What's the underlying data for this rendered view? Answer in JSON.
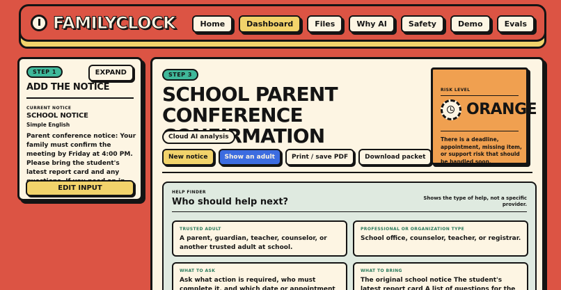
{
  "brand": {
    "name": "FAMILYCLOCK",
    "logo_icon": "clock-logo-icon"
  },
  "nav": {
    "items": [
      {
        "label": "Home",
        "active": false
      },
      {
        "label": "Dashboard",
        "active": true
      },
      {
        "label": "Files",
        "active": false
      },
      {
        "label": "Why AI",
        "active": false
      },
      {
        "label": "Safety",
        "active": false
      },
      {
        "label": "Demo",
        "active": false
      },
      {
        "label": "Evals",
        "active": false
      }
    ]
  },
  "left_panel": {
    "step": "STEP 1",
    "expand_label": "EXPAND",
    "title": "ADD THE NOTICE",
    "current_label": "CURRENT NOTICE",
    "current_title": "SCHOOL NOTICE",
    "language": "Simple English",
    "notice_text": "Parent conference notice: Your family must confirm the meeting by Friday at 4:00 PM. Please bring the student's latest report card and any questions. If you need an in...",
    "edit_label": "EDIT INPUT"
  },
  "main_panel": {
    "step": "STEP 3",
    "title": "SCHOOL PARENT CONFERENCE CONFIRMATION",
    "analysis_badge": "Cloud AI analysis",
    "actions": {
      "new_notice": "New notice",
      "show_adult": "Show an adult",
      "print": "Print / save PDF",
      "download": "Download packet"
    },
    "risk": {
      "label": "RISK LEVEL",
      "value": "ORANGE",
      "description": "There is a deadline, appointment, missing item, or support risk that should be handled soon.",
      "color": "#f0a050",
      "icon": "clock-icon"
    },
    "help_finder": {
      "label": "HELP FINDER",
      "title": "Who should help next?",
      "note": "Shows the type of help, not a specific provider.",
      "cards": [
        {
          "label": "TRUSTED ADULT",
          "text": "A parent, guardian, teacher, counselor, or another trusted adult at school."
        },
        {
          "label": "PROFESSIONAL OR ORGANIZATION TYPE",
          "text": "School office, counselor, teacher, or registrar."
        },
        {
          "label": "WHAT TO ASK",
          "text": "Ask what action is required, who must complete it, and which date or appointment should be verified."
        },
        {
          "label": "WHAT TO BRING",
          "text": "The original school notice The student's latest report card A list of questions for the teacher"
        }
      ]
    }
  },
  "colors": {
    "background": "#dc5444",
    "accent_yellow": "#f2d36b",
    "accent_green": "#3fb89a",
    "accent_blue": "#3c6ce0",
    "cream": "#fdf5e3",
    "help_bg": "#dfeae0"
  }
}
